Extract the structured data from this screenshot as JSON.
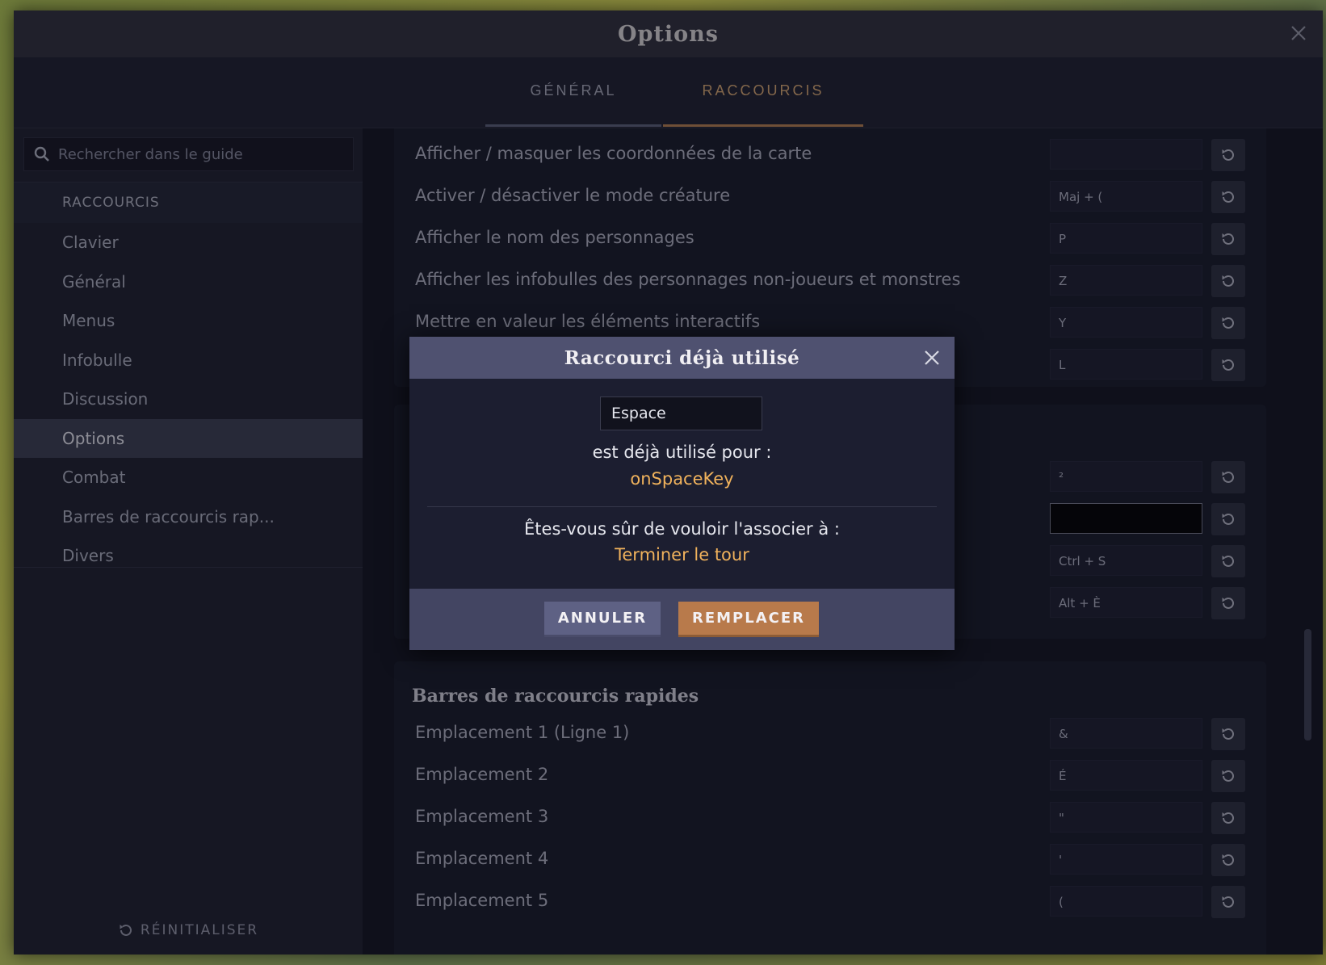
{
  "window": {
    "title": "Options"
  },
  "tabs": [
    {
      "label": "GÉNÉRAL"
    },
    {
      "label": "RACCOURCIS"
    }
  ],
  "sidebar": {
    "search_placeholder": "Rechercher dans le guide",
    "section_heading": "RACCOURCIS",
    "items": [
      {
        "label": "Clavier"
      },
      {
        "label": "Général"
      },
      {
        "label": "Menus"
      },
      {
        "label": "Infobulle"
      },
      {
        "label": "Discussion"
      },
      {
        "label": "Options",
        "active": true
      },
      {
        "label": "Combat"
      },
      {
        "label": "Barres de raccourcis rap..."
      },
      {
        "label": "Divers"
      }
    ],
    "reset_label": "RÉINITIALISER"
  },
  "options_rows": [
    {
      "label": "Afficher / masquer les coordonnées de la carte",
      "key": ""
    },
    {
      "label": "Activer / désactiver le mode créature",
      "key": "Maj + ("
    },
    {
      "label": "Afficher le nom des personnages",
      "key": "P"
    },
    {
      "label": "Afficher les infobulles des personnages non-joueurs et monstres",
      "key": "Z"
    },
    {
      "label": "Mettre en valeur les éléments interactifs",
      "key": "Y"
    },
    {
      "label": "",
      "key": "L"
    }
  ],
  "combat_rows": [
    {
      "label": "",
      "key": "²"
    },
    {
      "label": "",
      "key": ""
    },
    {
      "label": "",
      "key": "Ctrl + S"
    },
    {
      "label": "",
      "key": "Alt + È"
    }
  ],
  "quickbar": {
    "title": "Barres de raccourcis rapides",
    "rows": [
      {
        "label": "Emplacement 1 (Ligne 1)",
        "key": "&"
      },
      {
        "label": "Emplacement 2",
        "key": "É"
      },
      {
        "label": "Emplacement 3",
        "key": "\""
      },
      {
        "label": "Emplacement 4",
        "key": "'"
      },
      {
        "label": "Emplacement 5",
        "key": "("
      }
    ]
  },
  "dialog": {
    "title": "Raccourci déjà utilisé",
    "key_value": "Espace",
    "used_for_text": "est déjà utilisé pour :",
    "used_for_action": "onSpaceKey",
    "confirm_text": "Êtes-vous sûr de vouloir l'associer à :",
    "target_action": "Terminer le tour",
    "cancel_label": "ANNULER",
    "replace_label": "REMPLACER"
  },
  "colors": {
    "accent_gold": "#f0b25c",
    "active_tab": "#c79b6d",
    "replace_button": "#b87a4b",
    "cancel_button": "#5e6184"
  }
}
